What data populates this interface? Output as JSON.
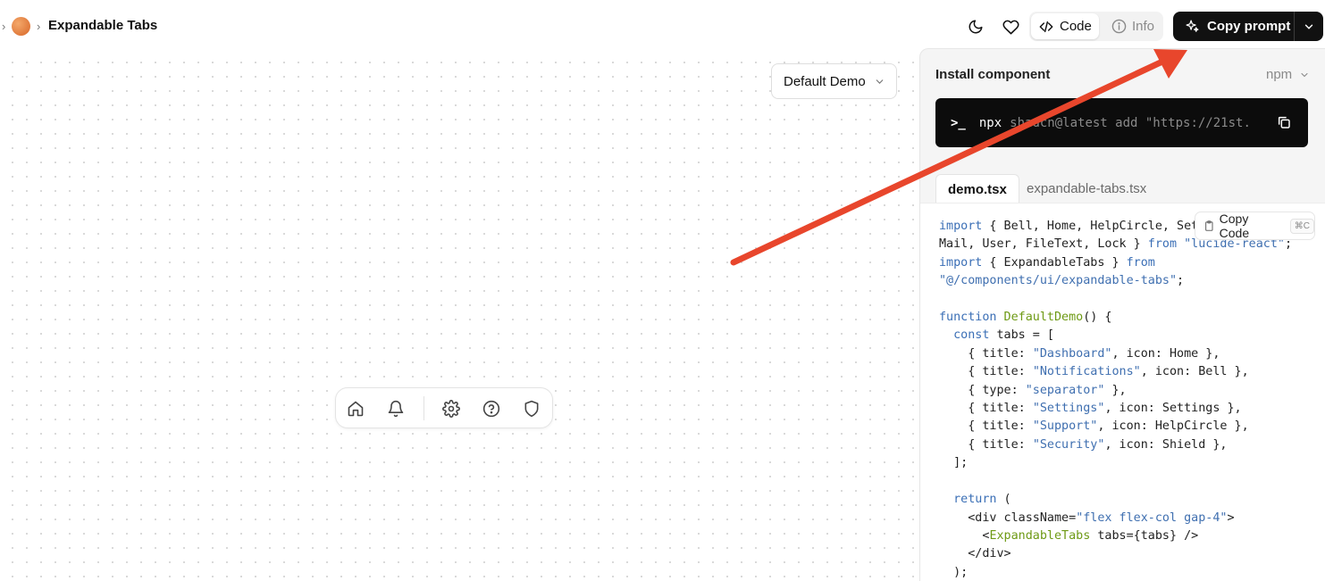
{
  "header": {
    "title": "Expandable Tabs",
    "theme_toggle_icon": "moon-icon",
    "favorite_icon": "heart-icon",
    "view_tabs": [
      {
        "label": "Code",
        "icon": "code-icon",
        "active": true
      },
      {
        "label": "Info",
        "icon": "info-icon",
        "active": false
      }
    ],
    "copy_prompt_label": "Copy prompt",
    "copy_prompt_icon": "sparkles-icon"
  },
  "preview": {
    "demo_select_value": "Default Demo",
    "tab_icons": [
      "home-icon",
      "bell-icon",
      "separator",
      "settings-icon",
      "help-circle-icon",
      "shield-icon"
    ]
  },
  "panel": {
    "install_label": "Install component",
    "package_manager": "npm",
    "command_prompt": ">_",
    "command_npx": "npx",
    "command_rest": "shadcn@latest add \"https://21st.",
    "file_tabs": [
      {
        "label": "demo.tsx",
        "active": true
      },
      {
        "label": "expandable-tabs.tsx",
        "active": false
      }
    ],
    "copy_code_label": "Copy Code",
    "copy_code_shortcut": "⌘C",
    "code_lines": [
      [
        [
          "kw",
          "import"
        ],
        [
          "",
          "{ Bell, Home, HelpCircle, Set"
        ]
      ],
      [
        [
          "",
          "Mail, User, FileText, Lock } "
        ],
        [
          "kw",
          "from"
        ],
        [
          "st",
          " \"lucide-react\""
        ],
        [
          "",
          ";"
        ]
      ],
      [
        [
          "kw",
          "import"
        ],
        [
          "",
          "{ ExpandableTabs } "
        ],
        [
          "kw",
          "from"
        ]
      ],
      [
        [
          "st",
          "\"@/components/ui/expandable-tabs\""
        ],
        [
          "",
          ";"
        ]
      ],
      [
        [
          "",
          ""
        ]
      ],
      [
        [
          "kw",
          "function"
        ],
        [
          "fn",
          " DefaultDemo"
        ],
        [
          "",
          "() {"
        ]
      ],
      [
        [
          "",
          "  "
        ],
        [
          "kw",
          "const"
        ],
        [
          "",
          " tabs = ["
        ]
      ],
      [
        [
          "",
          "    { title: "
        ],
        [
          "st",
          "\"Dashboard\""
        ],
        [
          "",
          ", icon: Home },"
        ]
      ],
      [
        [
          "",
          "    { title: "
        ],
        [
          "st",
          "\"Notifications\""
        ],
        [
          "",
          ", icon: Bell },"
        ]
      ],
      [
        [
          "",
          "    { type: "
        ],
        [
          "st",
          "\"separator\""
        ],
        [
          "",
          " },"
        ]
      ],
      [
        [
          "",
          "    { title: "
        ],
        [
          "st",
          "\"Settings\""
        ],
        [
          "",
          ", icon: Settings },"
        ]
      ],
      [
        [
          "",
          "    { title: "
        ],
        [
          "st",
          "\"Support\""
        ],
        [
          "",
          ", icon: HelpCircle },"
        ]
      ],
      [
        [
          "",
          "    { title: "
        ],
        [
          "st",
          "\"Security\""
        ],
        [
          "",
          ", icon: Shield },"
        ]
      ],
      [
        [
          "",
          "  ];"
        ]
      ],
      [
        [
          "",
          ""
        ]
      ],
      [
        [
          "",
          "  "
        ],
        [
          "kw",
          "return"
        ],
        [
          "",
          " ("
        ]
      ],
      [
        [
          "",
          "    <div className="
        ],
        [
          "st",
          "\"flex flex-col gap-4\""
        ],
        [
          "",
          ">"
        ]
      ],
      [
        [
          "",
          "      <"
        ],
        [
          "fn",
          "ExpandableTabs"
        ],
        [
          "",
          " tabs={tabs} />"
        ]
      ],
      [
        [
          "",
          "    </div>"
        ]
      ],
      [
        [
          "",
          "  );"
        ]
      ]
    ]
  }
}
